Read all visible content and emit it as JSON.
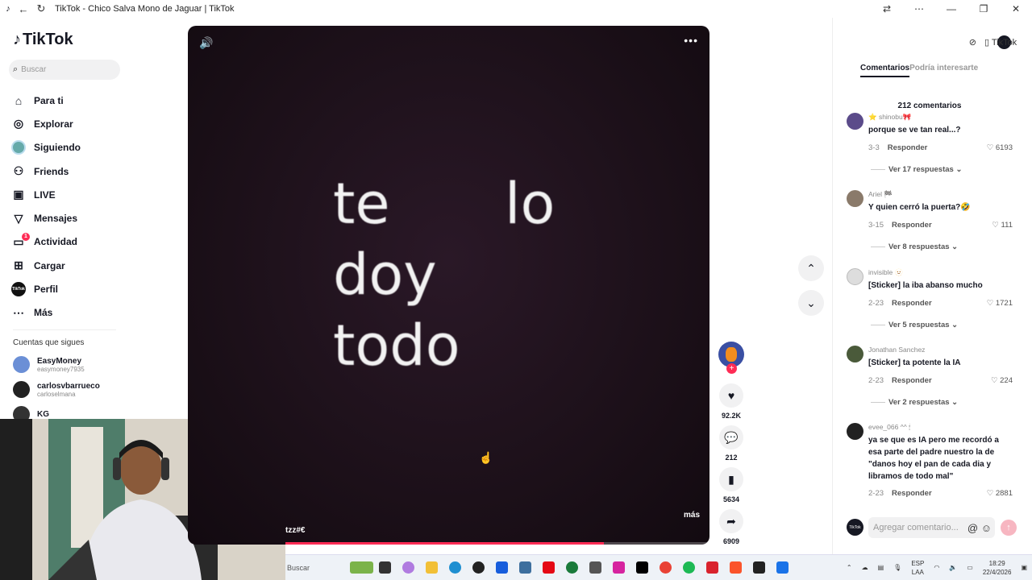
{
  "window": {
    "title": "TikTok - Chico Salva Mono de Jaguar | TikTok"
  },
  "sidebar": {
    "logo": "TikTok",
    "search_placeholder": "Buscar",
    "nav": [
      {
        "label": "Para ti",
        "icon": "home-icon"
      },
      {
        "label": "Explorar",
        "icon": "compass-icon"
      },
      {
        "label": "Siguiendo",
        "icon": "following-avatar-icon"
      },
      {
        "label": "Friends",
        "icon": "friends-icon"
      },
      {
        "label": "LIVE",
        "icon": "live-icon"
      },
      {
        "label": "Mensajes",
        "icon": "messages-icon"
      },
      {
        "label": "Actividad",
        "icon": "activity-icon",
        "badge": "1"
      },
      {
        "label": "Cargar",
        "icon": "upload-icon"
      },
      {
        "label": "Perfil",
        "icon": "profile-icon"
      },
      {
        "label": "Más",
        "icon": "more-icon"
      }
    ],
    "following_title": "Cuentas que sigues",
    "following": [
      {
        "name": "EasyMoney",
        "handle": "easymoney7935",
        "color": "#6b8fd6"
      },
      {
        "name": "carlosvbarrueco",
        "handle": "carloselmana",
        "color": "#222222"
      },
      {
        "name": "KG",
        "handle": "",
        "color": "#333333"
      }
    ]
  },
  "video": {
    "lyrics": [
      "te",
      "lo",
      "doy",
      "todo"
    ],
    "caption": "tzz#€",
    "more_label": "más",
    "progress": 0.75
  },
  "actions": {
    "likes": "92.2K",
    "comments": "212",
    "saves": "5634",
    "shares": "6909"
  },
  "panel": {
    "tabs": {
      "comments": "Comentarios",
      "related": "Podría interesarte"
    },
    "count_label": "212 comentarios",
    "comments": [
      {
        "user": "⭐ shinobu🎀",
        "text": "porque se ve tan real...?",
        "date": "3-3",
        "reply": "Responder",
        "likes": "6193",
        "replies": "Ver 17 respuestas",
        "color": "#5b4b8a"
      },
      {
        "user": "Ariel 🏁",
        "text": "Y quien cerró la puerta?🤣",
        "date": "3-15",
        "reply": "Responder",
        "likes": "111",
        "replies": "Ver 8 respuestas",
        "color": "#8a7a6a"
      },
      {
        "user": "invisible 🫥",
        "text": "[Sticker] la iba abanso mucho",
        "date": "2-23",
        "reply": "Responder",
        "likes": "1721",
        "replies": "Ver 5 respuestas",
        "color": "#dddddd"
      },
      {
        "user": "Jonathan Sanchez",
        "text": "[Sticker] ta potente la IA",
        "date": "2-23",
        "reply": "Responder",
        "likes": "224",
        "replies": "Ver 2 respuestas",
        "color": "#4a5a3a"
      },
      {
        "user": "evee_066 ^^ 🕯",
        "text": "ya se que es IA pero me recordó a esa parte del padre nuestro la de \"danos hoy el pan de cada dia y libramos de todo mal\"",
        "date": "2-23",
        "reply": "Responder",
        "likes": "2881",
        "replies": "",
        "color": "#222222"
      }
    ],
    "composer_placeholder": "Agregar comentario..."
  },
  "taskbar": {
    "search_label": "Buscar",
    "lang": "ESP",
    "lang2": "LAA",
    "time": "18:29",
    "date": "22/4/2026"
  }
}
